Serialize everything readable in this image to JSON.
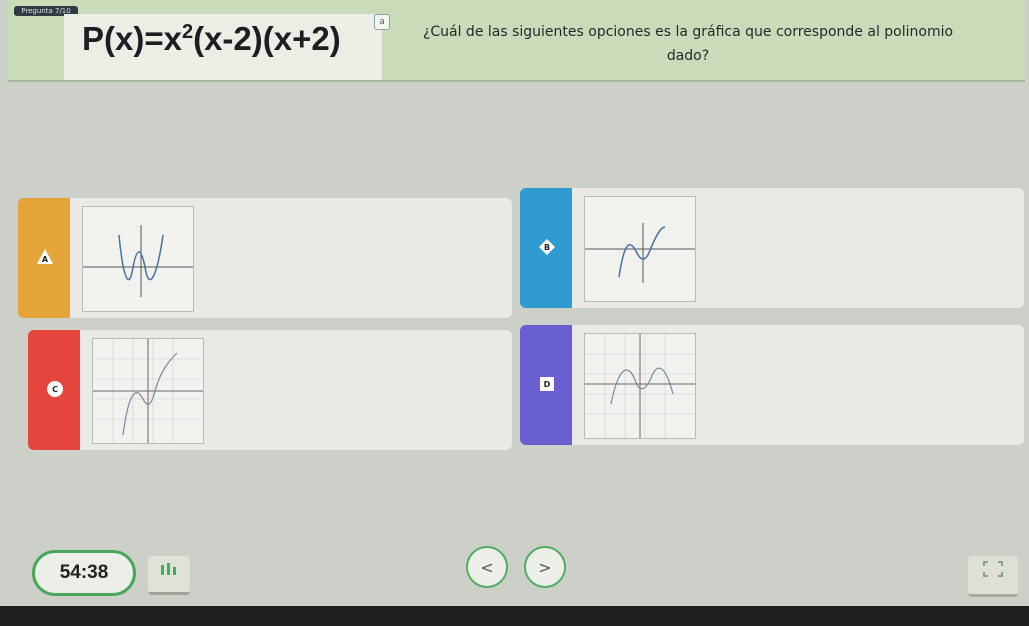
{
  "header": {
    "badge": "Pregunta 7/10",
    "formula": {
      "lhs": "P(x)=x",
      "exp": "2",
      "rhs": "(x-2)(x+2)"
    },
    "formula_icon": "a",
    "prompt": "¿Cuál de las siguientes opciones es la gráfica que corresponde al polinomio dado?"
  },
  "answers": [
    {
      "letter": "A",
      "color": "#e4a43a",
      "shape": "triangle-icon"
    },
    {
      "letter": "B",
      "color": "#2f9bd0",
      "shape": "diamond-icon"
    },
    {
      "letter": "C",
      "color": "#e4463e",
      "shape": "circle-icon"
    },
    {
      "letter": "D",
      "color": "#6a5fd0",
      "shape": "square-icon"
    }
  ],
  "footer": {
    "timer": "54:38",
    "prev": "<",
    "next": ">"
  }
}
